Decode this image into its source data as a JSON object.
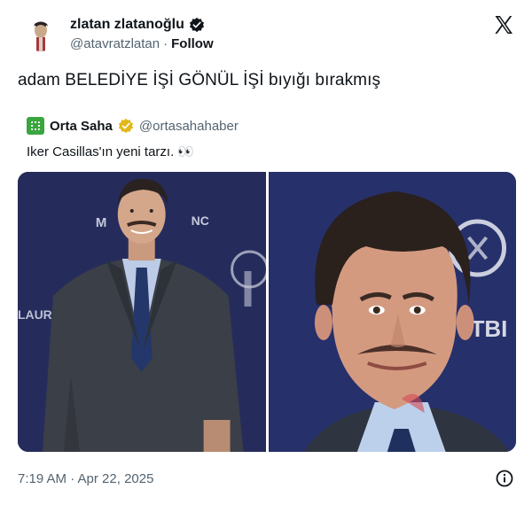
{
  "author": {
    "display_name": "zlatan zlatanoğlu",
    "handle": "@atavratzlatan",
    "separator": "·",
    "follow_label": "Follow",
    "verified_icon": "verified-badge-icon",
    "avatar_icon": "profile-avatar"
  },
  "brand_icon": "x-logo-icon",
  "tweet": {
    "text": "adam BELEDİYE İŞİ GÖNÜL İŞİ bıyığı bırakmış"
  },
  "quoted_tweet": {
    "display_name": "Orta Saha",
    "handle": "@ortasahahaber",
    "text": "Iker Casillas'ın yeni tarzı. 👀",
    "verified_icon": "gold-verified-badge-icon",
    "avatar_color": "#3aa63f",
    "images": [
      {
        "name": "media-photo-full-body",
        "description_icon": "photo"
      },
      {
        "name": "media-photo-closeup",
        "description_icon": "photo"
      }
    ]
  },
  "footer": {
    "timestamp": "7:19 AM · Apr 22, 2025",
    "info_icon": "info-icon"
  },
  "colors": {
    "text_primary": "#0f1419",
    "text_secondary": "#536471",
    "verified_blue": "#1d9bf0",
    "verified_gold": "#e2b719",
    "backdrop_navy": "#252b53"
  }
}
